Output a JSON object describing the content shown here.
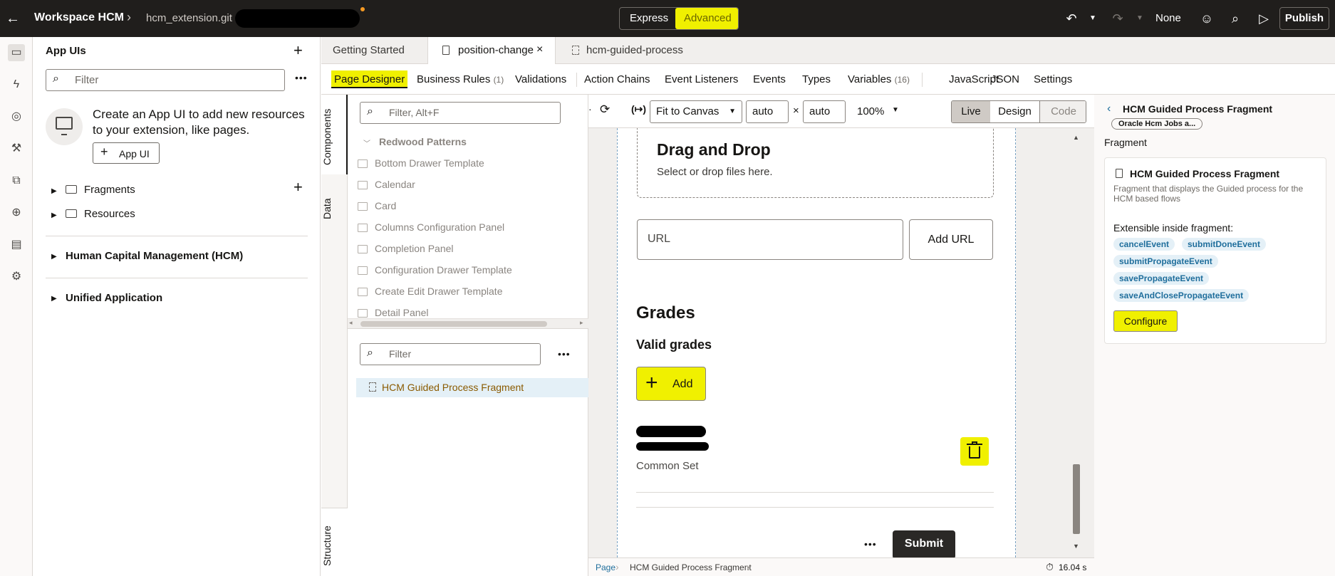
{
  "topbar": {
    "back_icon": "back-arrow-icon",
    "app_name": "Workspace HCM",
    "separator": "›",
    "repo": "hcm_extension.git",
    "mode_express": "Express",
    "mode_advanced": "Advanced",
    "branch": "None",
    "publish": "Publish"
  },
  "left_rail": {
    "icons": [
      "monitor-icon",
      "lightning-icon",
      "event-icon",
      "wrench-icon",
      "extension-icon",
      "globe-icon",
      "document-icon",
      "services-icon"
    ]
  },
  "app_uis": {
    "title": "App UIs",
    "filter_placeholder": "Filter",
    "empty_message_line1": "Create an App UI to add new resources",
    "empty_message_line2": "to your extension, like pages.",
    "create_button": "App UI",
    "tree": {
      "fragments": "Fragments",
      "resources": "Resources",
      "hcm": "Human Capital Management (HCM)",
      "unified": "Unified Application"
    }
  },
  "tabs": [
    {
      "label": "Getting Started"
    },
    {
      "label": "position-change"
    },
    {
      "label": "hcm-guided-process"
    }
  ],
  "subtabs": {
    "page_designer": "Page Designer",
    "business_rules": "Business Rules",
    "business_rules_count": "(1)",
    "validations": "Validations",
    "action_chains": "Action Chains",
    "event_listeners": "Event Listeners",
    "events": "Events",
    "types": "Types",
    "variables": "Variables",
    "variables_count": "(16)",
    "javascript": "JavaScript",
    "json": "JSON",
    "settings": "Settings"
  },
  "vertical_tabs": {
    "components": "Components",
    "data": "Data",
    "structure": "Structure"
  },
  "components": {
    "filter_placeholder": "Filter, Alt+F",
    "group": "Redwood Patterns",
    "items": [
      "Bottom Drawer Template",
      "Calendar",
      "Card",
      "Columns Configuration Panel",
      "Completion Panel",
      "Configuration Drawer Template",
      "Create Edit Drawer Template",
      "Detail Panel"
    ],
    "structure_filter_placeholder": "Filter",
    "structure_item": "HCM Guided Process Fragment"
  },
  "canvas_toolbar": {
    "fit": "Fit to Canvas",
    "width": "auto",
    "times": "×",
    "height": "auto",
    "zoom": "100%",
    "live": "Live",
    "design": "Design",
    "code": "Code"
  },
  "canvas": {
    "drag_title": "Drag and Drop",
    "drag_sub": "Select or drop files here.",
    "url_placeholder": "URL",
    "add_url": "Add URL",
    "grades_title": "Grades",
    "valid_grades": "Valid grades",
    "add": "Add",
    "grade_set": "Common Set",
    "submit": "Submit",
    "more": "•••"
  },
  "statusbar": {
    "crumb1": "Page",
    "crumb2": "HCM Guided Process Fragment",
    "timer": "16.04 s"
  },
  "properties": {
    "back_title": "HCM Guided Process Fragment",
    "badge": "Oracle Hcm Jobs a...",
    "section": "Fragment",
    "card_title": "HCM Guided Process Fragment",
    "card_desc_line1": "Fragment that displays the Guided process for the",
    "card_desc_line2": "HCM based flows",
    "extensible_label": "Extensible inside fragment:",
    "events": [
      "cancelEvent",
      "submitDoneEvent",
      "submitPropagateEvent",
      "savePropagateEvent",
      "saveAndClosePropagateEvent"
    ],
    "configure": "Configure"
  },
  "colors": {
    "highlight": "#f0f000",
    "topbar": "#201e1c",
    "link": "#1f6e9c"
  }
}
